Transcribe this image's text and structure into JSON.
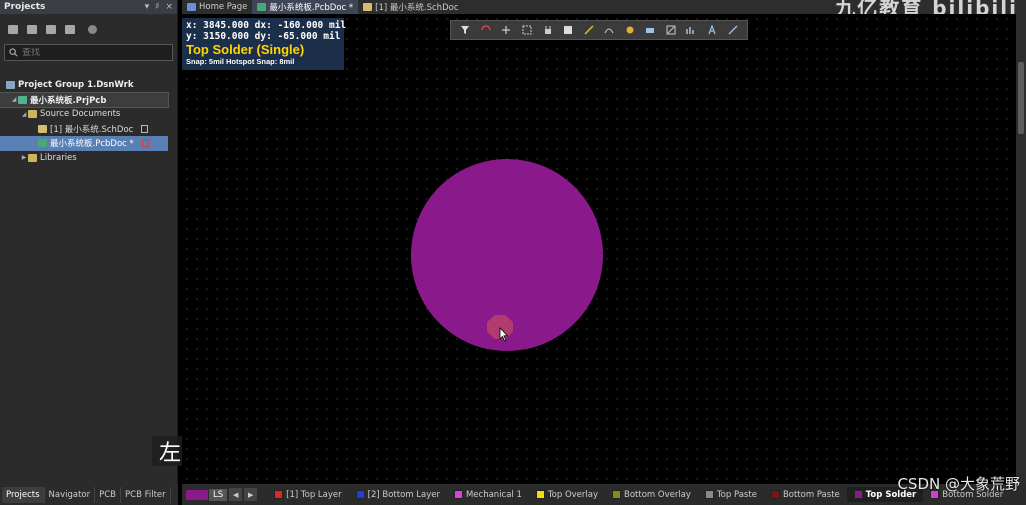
{
  "panel": {
    "title": "Projects",
    "ctrl_menu": "▾",
    "ctrl_pin": "♯",
    "ctrl_close": "×",
    "search_placeholder": "查找",
    "tree": [
      {
        "label": "Project Group 1.DsnWrk"
      },
      {
        "label": "最小系统板.PrjPcb"
      },
      {
        "label": "Source Documents"
      },
      {
        "label": "[1] 最小系统.SchDoc"
      },
      {
        "label": "最小系统板.PcbDoc *"
      },
      {
        "label": "Libraries"
      }
    ],
    "bottom_tabs": [
      "Projects",
      "Navigator",
      "PCB",
      "PCB Filter"
    ]
  },
  "subtitle": "左键",
  "doc_tabs": [
    {
      "label": "Home Page"
    },
    {
      "label": "最小系统板.PcbDoc *"
    },
    {
      "label": "[1] 最小系统.SchDoc"
    }
  ],
  "watermark": "九亿教育 bilibili",
  "coords": {
    "x_line": "x:  3845.000   dx:  -160.000 mil",
    "y_line": "y:  3150.000   dy:   -65.000  mil",
    "layer": "Top Solder (Single)",
    "snap": "Snap: 5mil Hotspot Snap: 8mil"
  },
  "toolbar_icons": [
    "filter-icon",
    "route-icon",
    "cross-icon",
    "select-rect-icon",
    "component-icon",
    "layer-icon",
    "track-icon",
    "arc-icon",
    "pad-icon",
    "fill-icon",
    "polygon-icon",
    "chart-icon",
    "text-icon",
    "line-icon"
  ],
  "layer_bar": {
    "ls_label": "LS",
    "prev": "◀",
    "next": "▶",
    "layers": [
      {
        "label": "[1] Top Layer",
        "color": "#e0261e"
      },
      {
        "label": "[2] Bottom Layer",
        "color": "#1f3de0"
      },
      {
        "label": "Mechanical 1",
        "color": "#e03fe0"
      },
      {
        "label": "Top Overlay",
        "color": "#f0e000"
      },
      {
        "label": "Bottom Overlay",
        "color": "#8a8a1a"
      },
      {
        "label": "Top Paste",
        "color": "#8a8a8a"
      },
      {
        "label": "Bottom Paste",
        "color": "#7a1515"
      },
      {
        "label": "Top Solder",
        "color": "#8a1a8c"
      },
      {
        "label": "Bottom Solder",
        "color": "#d040d0"
      }
    ]
  },
  "csdn": "CSDN @大象荒野",
  "colors": {
    "pad": "#8a1a8c",
    "hover_pad": "#b33a6d",
    "coord_bg": "#1c2f4a",
    "layer_label": "#ffd500"
  }
}
